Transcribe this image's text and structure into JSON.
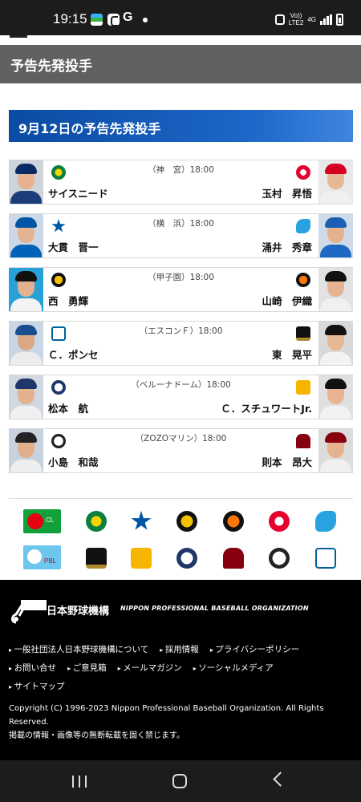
{
  "status_bar": {
    "time": "19:15",
    "g_label": "G",
    "network_line1": "Vo))",
    "network_line2": "LTE2",
    "network_type": "4G"
  },
  "header": {
    "title": "予告先発投手"
  },
  "date_heading": "9月12日の予告先発投手",
  "games": [
    {
      "venue": "（神　宮）18:00",
      "home_pitcher": "サイスニード",
      "away_pitcher": "玉村　昇悟",
      "home_team_icon": "swallows-icon",
      "away_team_icon": "carp-icon",
      "home_color": "#0b7f3f",
      "away_color": "#e5002d"
    },
    {
      "venue": "（横　浜）18:00",
      "home_pitcher": "大貫　晋一",
      "away_pitcher": "涌井　秀章",
      "home_team_icon": "baystars-icon",
      "away_team_icon": "dragons-icon",
      "home_color": "#0055a5",
      "away_color": "#1a77c9"
    },
    {
      "venue": "（甲子園）18:00",
      "home_pitcher": "西　勇輝",
      "away_pitcher": "山崎　伊織",
      "home_team_icon": "tigers-icon",
      "away_team_icon": "giants-icon",
      "home_color": "#f3c200",
      "away_color": "#f97709"
    },
    {
      "venue": "（エスコンＦ）18:00",
      "home_pitcher": "Ｃ．ポンセ",
      "away_pitcher": "東　晃平",
      "home_team_icon": "fighters-icon",
      "away_team_icon": "buffaloes-icon",
      "home_color": "#006298",
      "away_color": "#b08a2e"
    },
    {
      "venue": "（ベルーナドーム）18:00",
      "home_pitcher": "松本　航",
      "away_pitcher": "Ｃ．スチュワートJr.",
      "home_team_icon": "lions-icon",
      "away_team_icon": "hawks-icon",
      "home_color": "#1f366a",
      "away_color": "#f8b500"
    },
    {
      "venue": "（ZOZOマリン）18:00",
      "home_pitcher": "小島　和哉",
      "away_pitcher": "則本　昂大",
      "home_team_icon": "marines-icon",
      "away_team_icon": "eagles-icon",
      "home_color": "#222222",
      "away_color": "#860010"
    }
  ],
  "footer": {
    "org_name_ja": "日本野球機構",
    "org_name_en": "NIPPON PROFESSIONAL BASEBALL ORGANIZATION",
    "links_row1": [
      "一般社団法人日本野球機構について",
      "採用情報",
      "プライバシーポリシー"
    ],
    "links_row2": [
      "お問い合せ",
      "ご意見箱",
      "メールマガジン",
      "ソーシャルメディア"
    ],
    "links_row3": [
      "サイトマップ"
    ],
    "copyright": "Copyright (C) 1996-2023 Nippon Professional Baseball Organization. All Rights Reserved.",
    "notice": "掲載の情報・画像等の無断転載を固く禁じます。"
  },
  "logo_grid": {
    "central_league_label": "CL",
    "pacific_league_label": "PBL"
  }
}
